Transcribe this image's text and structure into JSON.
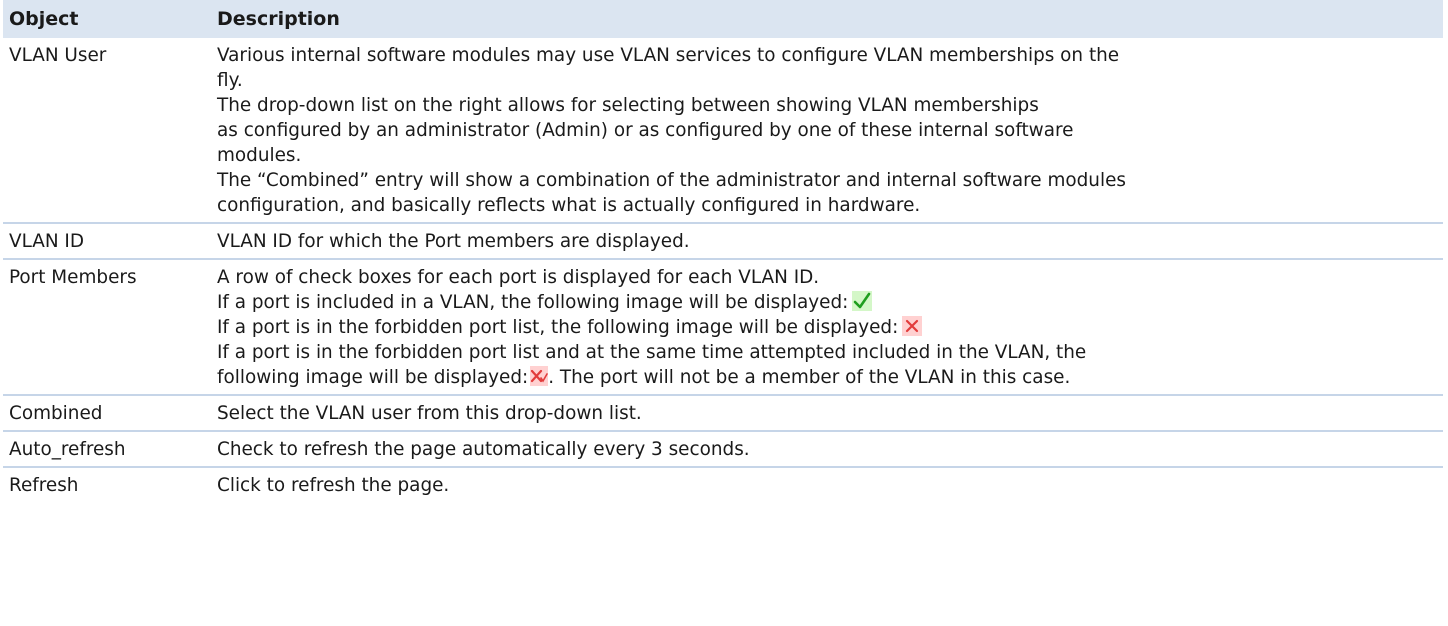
{
  "table": {
    "headers": {
      "object": "Object",
      "description": "Description"
    },
    "rows": [
      {
        "object": "VLAN User",
        "lines": [
          "Various internal software modules may use VLAN services to configure VLAN memberships on the",
          "fly.",
          "The drop-down list on the right allows for selecting between showing VLAN memberships",
          "as configured by an administrator (Admin) or as configured by one of these internal software",
          "modules.",
          "The “Combined” entry will show a combination of the administrator and internal software modules",
          "configuration, and basically reflects what is actually configured in hardware."
        ]
      },
      {
        "object": "VLAN ID",
        "lines": [
          "VLAN ID for which the Port members are displayed."
        ]
      },
      {
        "object": "Port Members",
        "lines": [
          "A row of check boxes for each port is displayed for each VLAN ID.",
          "If a port is included in a VLAN, the following image will be displayed:",
          "If a port is in the forbidden port list, the following image will be displayed:",
          "If a port is in the forbidden port list and at the same time attempted included in the VLAN, the",
          "following image will be displayed:",
          ". The port will not be a member of the VLAN in this case."
        ]
      },
      {
        "object": "Combined",
        "lines": [
          "Select the VLAN user from this drop-down list."
        ]
      },
      {
        "object": "Auto_refresh",
        "lines": [
          "Check to refresh the page automatically every 3 seconds."
        ]
      },
      {
        "object": "Refresh",
        "lines": [
          "Click to refresh the page."
        ]
      }
    ]
  },
  "icons": {
    "included": "check-icon",
    "forbidden": "forbidden-x-icon",
    "conflict": "forbidden-included-icon"
  },
  "colors": {
    "header_bg": "#dbe5f1",
    "row_separator": "#c6d5e8",
    "check_green": "#1f9e1f",
    "check_bg": "#d4f7c8",
    "x_red": "#e23c3c",
    "x_bg": "#ffd1d1"
  }
}
